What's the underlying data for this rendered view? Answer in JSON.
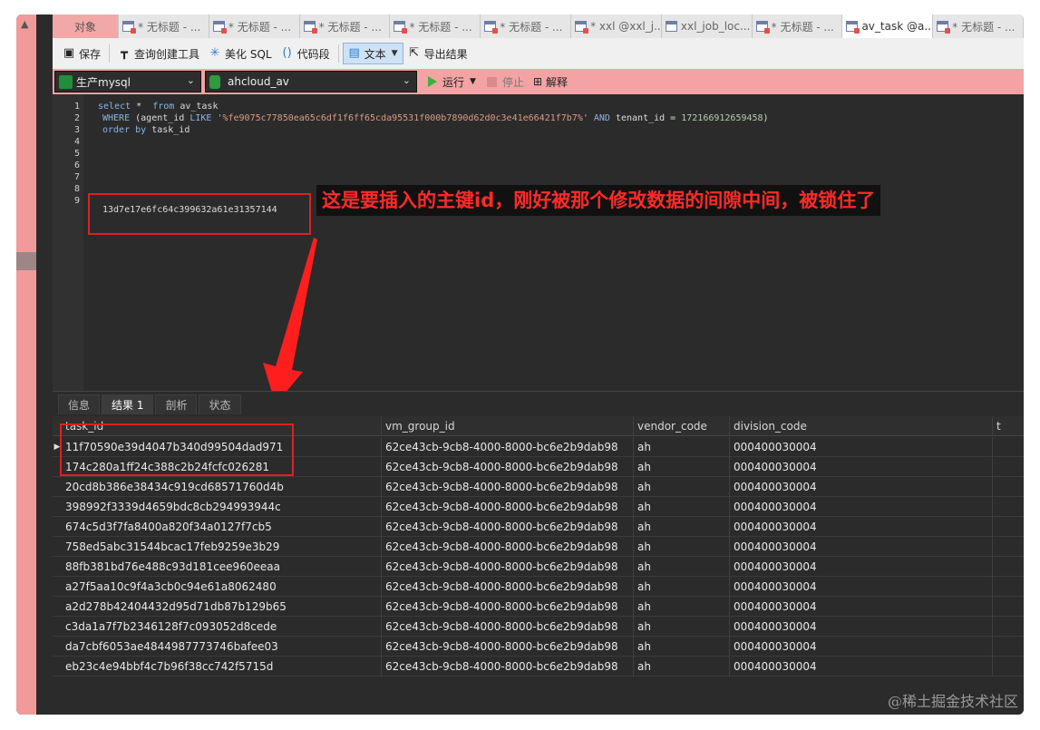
{
  "tabs": [
    {
      "label": "对象",
      "icon": "none"
    },
    {
      "label": "* 无标题 - ...",
      "icon": "query-icon"
    },
    {
      "label": "* 无标题 - ...",
      "icon": "query-icon"
    },
    {
      "label": "* 无标题 - ...",
      "icon": "query-icon"
    },
    {
      "label": "* 无标题 - ...",
      "icon": "query-icon"
    },
    {
      "label": "* 无标题 - ...",
      "icon": "query-icon"
    },
    {
      "label": "* xxl @xxl_j...",
      "icon": "query-icon"
    },
    {
      "label": "xxl_job_loc...",
      "icon": "table-icon"
    },
    {
      "label": "* 无标题 - ...",
      "icon": "query-icon"
    },
    {
      "label": "av_task @a...",
      "icon": "query-icon"
    },
    {
      "label": "* 无标题 - ...",
      "icon": "query-icon"
    }
  ],
  "toolbar": {
    "save": "保存",
    "query_builder": "查询创建工具",
    "beautify": "美化 SQL",
    "snippet": "代码段",
    "text": "文本",
    "export": "导出结果"
  },
  "connection": {
    "connection_name": "生产mysql",
    "database_name": "ahcloud_av",
    "run": "运行",
    "stop": "停止",
    "explain": "解释"
  },
  "editor": {
    "line_numbers": [
      "1",
      "2",
      "3",
      "4",
      "5",
      "6",
      "7",
      "8",
      "9"
    ],
    "line1_kw1": "select",
    "line1_rest": " *  ",
    "line1_kw2": "from",
    "line1_table": " av_task",
    "line2_kw1": "WHERE",
    "line2_mid": " (agent_id ",
    "line2_kw2": "LIKE",
    "line2_str": " '%fe9075c77850ea65c6df1f6ff65cda95531f000b7890d62d0c3e41e66421f7b7%'",
    "line2_kw3": " AND",
    "line2_tail": " tenant_id = ",
    "line2_num": "172166912659458",
    "line2_end": ")",
    "line3_kw": "order by",
    "line3_rest": " task_id",
    "line9_text": "13d7e17e6fc64c399632a61e31357144"
  },
  "annotation": {
    "text": "这是要插入的主键id，刚好被那个修改数据的间隙中间，被锁住了",
    "color": "#ff2a2a"
  },
  "result_tabs": [
    "信息",
    "结果 1",
    "剖析",
    "状态"
  ],
  "grid": {
    "columns": [
      "task_id",
      "vm_group_id",
      "vendor_code",
      "division_code",
      "t"
    ],
    "rows": [
      [
        "11f70590e39d4047b340d99504dad971",
        "62ce43cb-9cb8-4000-8000-bc6e2b9dab98",
        "ah",
        "000400030004"
      ],
      [
        "174c280a1ff24c388c2b24fcfc026281",
        "62ce43cb-9cb8-4000-8000-bc6e2b9dab98",
        "ah",
        "000400030004"
      ],
      [
        "20cd8b386e38434c919cd68571760d4b",
        "62ce43cb-9cb8-4000-8000-bc6e2b9dab98",
        "ah",
        "000400030004"
      ],
      [
        "398992f3339d4659bdc8cb294993944c",
        "62ce43cb-9cb8-4000-8000-bc6e2b9dab98",
        "ah",
        "000400030004"
      ],
      [
        "674c5d3f7fa8400a820f34a0127f7cb5",
        "62ce43cb-9cb8-4000-8000-bc6e2b9dab98",
        "ah",
        "000400030004"
      ],
      [
        "758ed5abc31544bcac17feb9259e3b29",
        "62ce43cb-9cb8-4000-8000-bc6e2b9dab98",
        "ah",
        "000400030004"
      ],
      [
        "88fb381bd76e488c93d181cee960eeaa",
        "62ce43cb-9cb8-4000-8000-bc6e2b9dab98",
        "ah",
        "000400030004"
      ],
      [
        "a27f5aa10c9f4a3cb0c94e61a8062480",
        "62ce43cb-9cb8-4000-8000-bc6e2b9dab98",
        "ah",
        "000400030004"
      ],
      [
        "a2d278b42404432d95d71db87b129b65",
        "62ce43cb-9cb8-4000-8000-bc6e2b9dab98",
        "ah",
        "000400030004"
      ],
      [
        "c3da1a7f7b2346128f7c093052d8cede",
        "62ce43cb-9cb8-4000-8000-bc6e2b9dab98",
        "ah",
        "000400030004"
      ],
      [
        "da7cbf6053ae4844987773746bafee03",
        "62ce43cb-9cb8-4000-8000-bc6e2b9dab98",
        "ah",
        "000400030004"
      ],
      [
        "eb23c4e94bbf4c7b96f38cc742f5715d",
        "62ce43cb-9cb8-4000-8000-bc6e2b9dab98",
        "ah",
        "000400030004"
      ]
    ]
  },
  "watermark": "@稀土掘金技术社区"
}
